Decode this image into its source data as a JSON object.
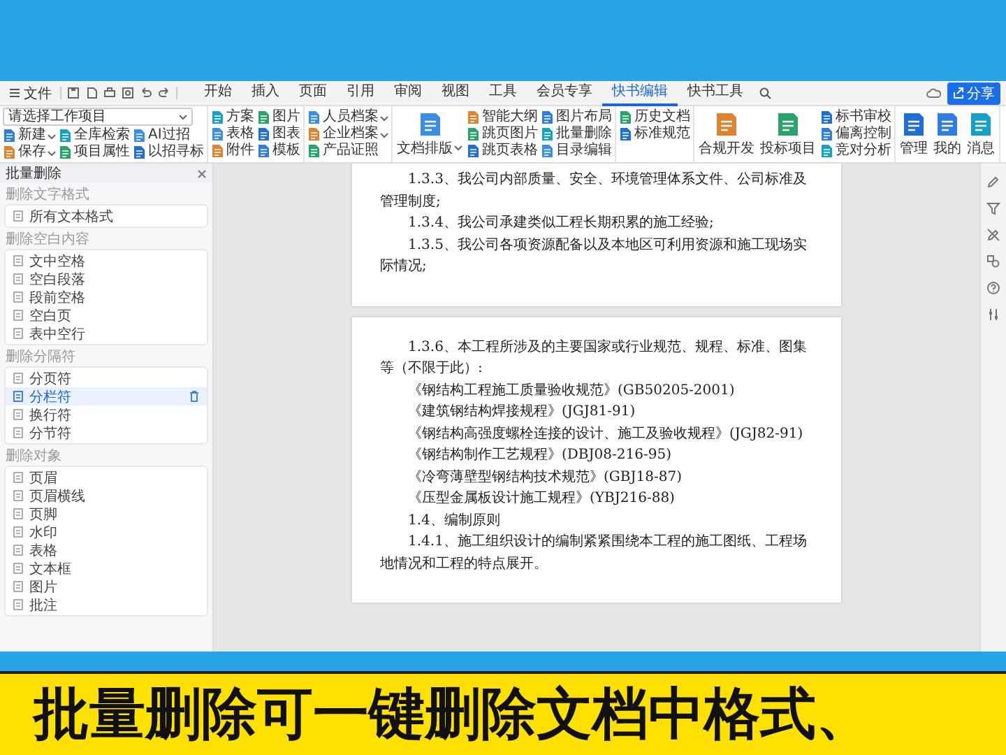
{
  "menu_bar": {
    "file_menu": "文件",
    "tabs": [
      {
        "label": "开始",
        "selected": false
      },
      {
        "label": "插入",
        "selected": false
      },
      {
        "label": "页面",
        "selected": false
      },
      {
        "label": "引用",
        "selected": false
      },
      {
        "label": "审阅",
        "selected": false
      },
      {
        "label": "视图",
        "selected": false
      },
      {
        "label": "工具",
        "selected": false
      },
      {
        "label": "会员专享",
        "selected": false
      },
      {
        "label": "快书编辑",
        "selected": true
      },
      {
        "label": "快书工具",
        "selected": false
      }
    ],
    "share_button": "分享"
  },
  "ribbon": {
    "groups": [
      {
        "kind": "project",
        "select": {
          "value": "请选择工作项目"
        },
        "items": [
          {
            "label": "新建",
            "dropdown": true
          },
          {
            "label": "全库检索",
            "dropdown": false
          },
          {
            "label": "AI过招",
            "dropdown": false
          },
          {
            "label": "保存",
            "dropdown": true
          },
          {
            "label": "项目属性",
            "dropdown": false
          },
          {
            "label": "以招寻标",
            "dropdown": false
          }
        ]
      },
      {
        "kind": "stack",
        "items": [
          {
            "label": "方案",
            "dropdown": false
          },
          {
            "label": "表格",
            "dropdown": false
          },
          {
            "label": "附件",
            "dropdown": false
          },
          {
            "label": "图片",
            "dropdown": false
          },
          {
            "label": "图表",
            "dropdown": false
          },
          {
            "label": "模板",
            "dropdown": false
          }
        ]
      },
      {
        "kind": "stack",
        "items": [
          {
            "label": "人员档案",
            "dropdown": true
          },
          {
            "label": "企业档案",
            "dropdown": true
          },
          {
            "label": "产品证照",
            "dropdown": false
          }
        ]
      },
      {
        "kind": "stack",
        "large": [
          {
            "label": "文档排版",
            "dropdown": true
          }
        ],
        "items": [
          {
            "label": "智能大纲",
            "dropdown": false
          },
          {
            "label": "跳页图片",
            "dropdown": false
          },
          {
            "label": "跳页表格",
            "dropdown": false
          },
          {
            "label": "图片布局",
            "dropdown": false
          },
          {
            "label": "批量删除",
            "dropdown": false
          },
          {
            "label": "目录编辑",
            "dropdown": false
          }
        ]
      },
      {
        "kind": "stack",
        "items": [
          {
            "label": "历史文档",
            "dropdown": false
          },
          {
            "label": "标准规范",
            "dropdown": false
          }
        ]
      },
      {
        "kind": "stack",
        "large": [
          {
            "label": "合规开发",
            "dropdown": false
          },
          {
            "label": "投标项目",
            "dropdown": false
          }
        ],
        "items": [
          {
            "label": "标书审校",
            "dropdown": false
          },
          {
            "label": "偏离控制",
            "dropdown": false
          },
          {
            "label": "竞对分析",
            "dropdown": false
          }
        ]
      },
      {
        "kind": "stack",
        "large": [
          {
            "label": "管理",
            "dropdown": false
          },
          {
            "label": "我的",
            "dropdown": false
          },
          {
            "label": "消息",
            "dropdown": false
          }
        ]
      }
    ]
  },
  "side_panel": {
    "title": "批量删除",
    "sections": [
      {
        "title": "删除文字格式",
        "items": [
          {
            "label": "所有文本格式",
            "selected": false
          }
        ]
      },
      {
        "title": "删除空白内容",
        "items": [
          {
            "label": "文中空格",
            "selected": false
          },
          {
            "label": "空白段落",
            "selected": false
          },
          {
            "label": "段前空格",
            "selected": false
          },
          {
            "label": "空白页",
            "selected": false
          },
          {
            "label": "表中空行",
            "selected": false
          }
        ]
      },
      {
        "title": "删除分隔符",
        "items": [
          {
            "label": "分页符",
            "selected": false
          },
          {
            "label": "分栏符",
            "selected": true
          },
          {
            "label": "换行符",
            "selected": false
          },
          {
            "label": "分节符",
            "selected": false
          }
        ]
      },
      {
        "title": "删除对象",
        "items": [
          {
            "label": "页眉",
            "selected": false
          },
          {
            "label": "页眉横线",
            "selected": false
          },
          {
            "label": "页脚",
            "selected": false
          },
          {
            "label": "水印",
            "selected": false
          },
          {
            "label": "表格",
            "selected": false
          },
          {
            "label": "文本框",
            "selected": false
          },
          {
            "label": "图片",
            "selected": false
          },
          {
            "label": "批注",
            "selected": false
          }
        ]
      }
    ]
  },
  "document": {
    "pages": [
      {
        "paragraphs": [
          "1.3.3、我公司内部质量、安全、环境管理体系文件、公司标准及管理制度;",
          "1.3.4、我公司承建类似工程长期积累的施工经验;",
          "1.3.5、我公司各项资源配备以及本地区可利用资源和施工现场实际情况;"
        ]
      },
      {
        "paragraphs": [
          "1.3.6、本工程所涉及的主要国家或行业规范、规程、标准、图集等（不限于此）:",
          "《钢结构工程施工质量验收规范》(GB50205-2001)",
          "《建筑钢结构焊接规程》(JGJ81-91)",
          "《钢结构高强度螺栓连接的设计、施工及验收规程》(JGJ82-91)",
          "《钢结构制作工艺规程》(DBJ08-216-95)",
          "《冷弯薄壁型钢结构技术规范》(GBJ18-87)",
          "《压型金属板设计施工规程》(YBJ216-88)",
          "1.4、编制原则",
          "1.4.1、施工组织设计的编制紧紧围绕本工程的施工图纸、工程场地情况和工程的特点展开。"
        ]
      }
    ]
  },
  "banner": {
    "text": "批量删除可一键删除文档中格式、"
  }
}
